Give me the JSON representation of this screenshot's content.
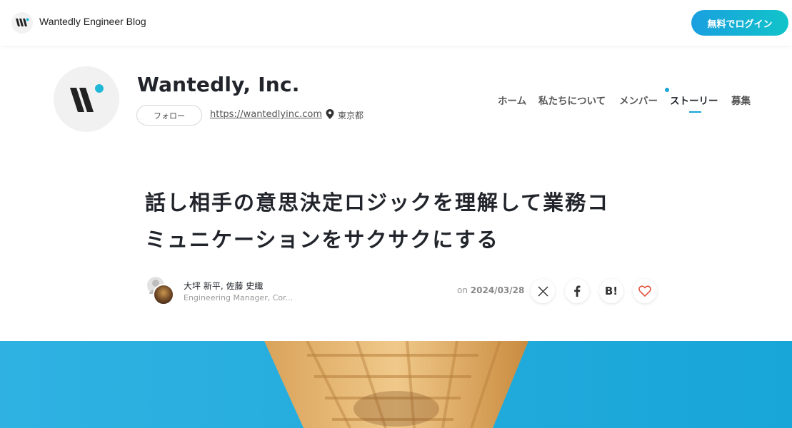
{
  "topbar": {
    "blog_title": "Wantedly Engineer Blog",
    "login_label": "無料でログイン"
  },
  "company": {
    "name": "Wantedly, Inc.",
    "follow_label": "フォロー",
    "url": "https://wantedlyinc.com",
    "location": "東京都"
  },
  "nav": {
    "items": [
      {
        "label": "ホーム"
      },
      {
        "label": "私たちについて"
      },
      {
        "label": "メンバー"
      },
      {
        "label": "ストーリー"
      },
      {
        "label": "募集"
      }
    ],
    "active": "ストーリー"
  },
  "article": {
    "title_line1": "話し相手の意思決定ロジックを理解して業務コ",
    "title_line2": "ミュニケーションをサクサクにする",
    "authors": "大坪 新平, 佐藤 史織",
    "author_role": "Engineering Manager, Cor...",
    "date_prefix": "on",
    "date": "2024/03/28"
  },
  "share": {
    "hatena_label": "B!"
  },
  "colors": {
    "accent": "#18a5d6",
    "login_gradient_start": "#1a9fe0",
    "login_gradient_end": "#11c4c9",
    "hero_background": "#2fb2e2",
    "like_heart": "#e0523a"
  }
}
